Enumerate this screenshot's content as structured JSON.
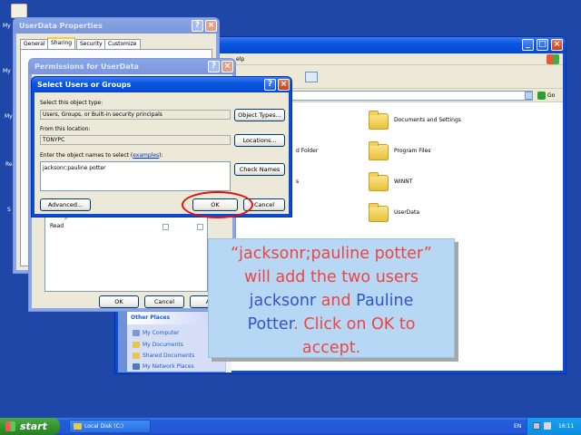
{
  "desktop": {
    "icons": [
      "My",
      "My",
      "My",
      "Re",
      "S"
    ]
  },
  "props_window": {
    "title": "UserData Properties",
    "tabs": [
      "General",
      "Sharing",
      "Security",
      "Customize"
    ]
  },
  "permissions_window": {
    "title": "Permissions for UserData",
    "rows": [
      "Change",
      "Read"
    ],
    "buttons": {
      "ok": "OK",
      "cancel": "Cancel",
      "apply": "A"
    }
  },
  "explorer": {
    "menu_partial": "elp",
    "folders_left": [
      "d Folder",
      "s"
    ],
    "folders_right": [
      "Documents and Settings",
      "Program Files",
      "WINNT",
      "UserData"
    ],
    "go_label": "Go",
    "other_places": {
      "heading": "Other Places",
      "links": [
        "My Computer",
        "My Documents",
        "Shared Documents",
        "My Network Places"
      ]
    }
  },
  "select_dialog": {
    "title": "Select Users or Groups",
    "object_type_label": "Select this object type:",
    "object_type_value": "Users, Groups, or Built-in security principals",
    "object_types_button": "Object Types...",
    "location_label": "From this location:",
    "location_value": "TONYPC",
    "locations_button": "Locations...",
    "names_label_prefix": "Enter the object names to select (",
    "names_label_link": "examples",
    "names_label_suffix": "):",
    "names_value": "jacksonr;pauline potter",
    "check_names_button": "Check Names",
    "advanced_button": "Advanced...",
    "ok_button": "OK",
    "cancel_button": "Cancel"
  },
  "callout": {
    "line1": "“jacksonr;pauline potter”",
    "line2": "will add the two users",
    "line3a": "jacksonr",
    "line3b": " and ",
    "line3c": "Pauline",
    "line4a": "Potter",
    "line4b": ". Click on OK to",
    "line5": "accept."
  },
  "taskbar": {
    "start_label": "start",
    "task_label": "Local Disk (C:)",
    "lang": "EN",
    "clock": "16:11"
  },
  "colors": {
    "desktop": "#1f47a8",
    "callout_bg": "#b7d8f4",
    "callout_red": "#ee4444",
    "callout_blue": "#3355cc",
    "highlight_ring": "#e01010"
  }
}
